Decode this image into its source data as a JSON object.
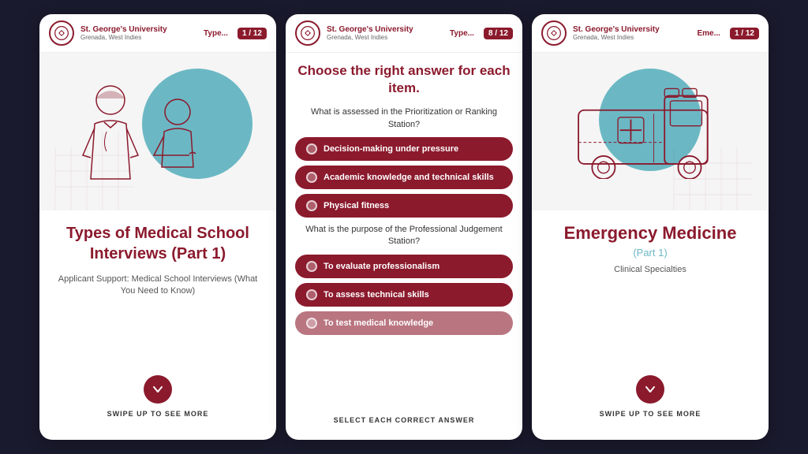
{
  "cards": [
    {
      "id": "card1",
      "header": {
        "logo_alt": "SGU Logo",
        "university": "St. George's University",
        "location": "Grenada, West Indies",
        "type_label": "Type...",
        "counter": "1 / 12"
      },
      "title": "Types of Medical School Interviews (Part 1)",
      "description": "Applicant Support: Medical School Interviews (What You Need to Know)",
      "swipe_label": "SWIPE UP TO SEE MORE"
    },
    {
      "id": "card2",
      "header": {
        "university": "St. George's University",
        "location": "Grenada, West Indies",
        "type_label": "Type...",
        "counter": "8 / 12"
      },
      "main_title": "Choose the right answer for each item.",
      "questions": [
        {
          "text": "What is assessed in the Prioritization or Ranking Station?",
          "options": [
            "Decision-making under pressure",
            "Academic knowledge and technical skills",
            "Physical fitness"
          ]
        },
        {
          "text": "What is the purpose of the Professional Judgement Station?",
          "options": [
            "To evaluate professionalism",
            "To assess technical skills",
            "To test medical knowledge"
          ]
        }
      ],
      "select_label": "SELECT EACH CORRECT ANSWER"
    },
    {
      "id": "card3",
      "header": {
        "university": "St. George's University",
        "location": "Grenada, West Indies",
        "type_label": "Eme...",
        "counter": "1 / 12"
      },
      "title": "Emergency Medicine",
      "subtitle": "(Part 1)",
      "description": "Clinical Specialties",
      "swipe_label": "SWIPE UP TO SEE MORE"
    }
  ]
}
